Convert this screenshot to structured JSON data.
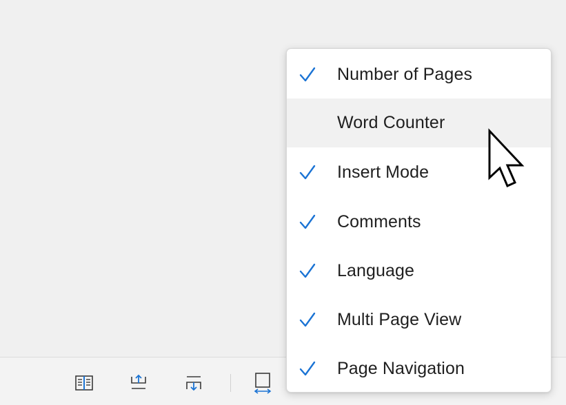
{
  "context_menu": {
    "items": [
      {
        "label": "Number of Pages",
        "checked": true
      },
      {
        "label": "Word Counter",
        "checked": false,
        "hovered": true
      },
      {
        "label": "Insert Mode",
        "checked": true
      },
      {
        "label": "Comments",
        "checked": true
      },
      {
        "label": "Language",
        "checked": true
      },
      {
        "label": "Multi Page View",
        "checked": true
      },
      {
        "label": "Page Navigation",
        "checked": true
      }
    ]
  },
  "statusbar": {
    "icons": [
      "book-view-icon",
      "page-up-icon",
      "page-down-icon",
      "fit-width-icon"
    ]
  },
  "colors": {
    "accent": "#1a73d4",
    "menu_background": "#ffffff",
    "hover_background": "#f1f1f1",
    "workspace_background": "#f0f0f0"
  }
}
